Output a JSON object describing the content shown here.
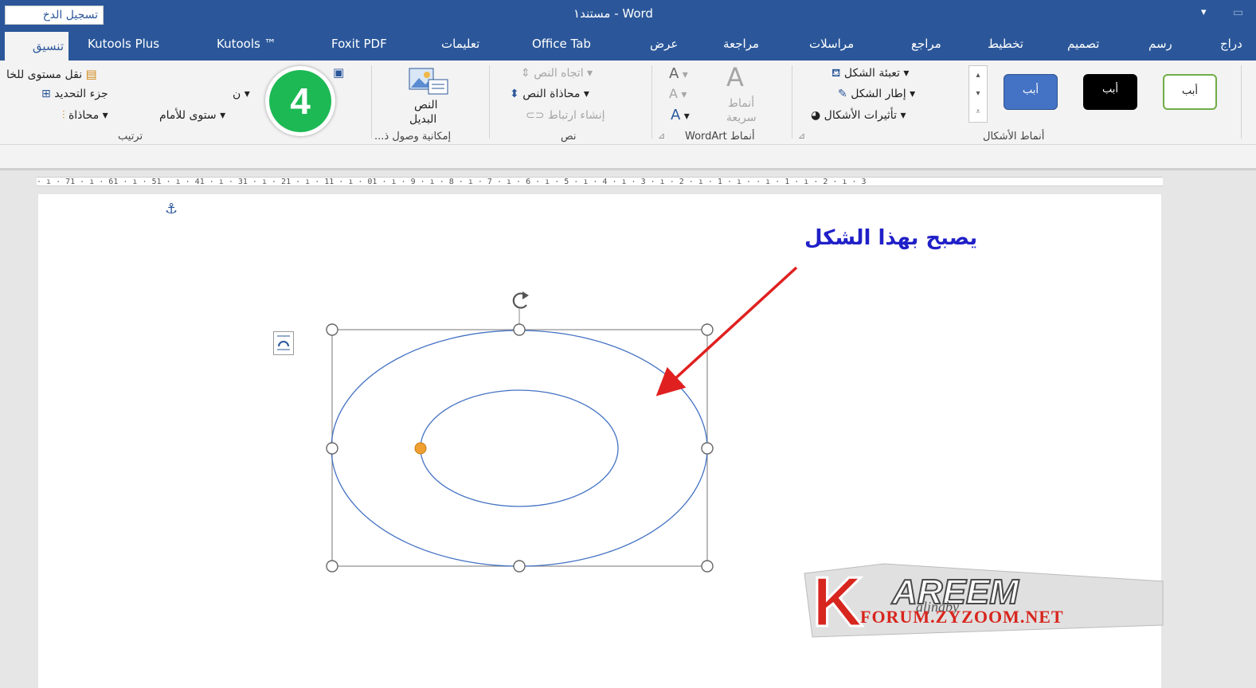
{
  "window": {
    "title": "مستند١ - Word",
    "signin": "تسجيل الدخ",
    "qat_icon": "qat-dropdown-icon"
  },
  "tabs": {
    "format": "تنسيق",
    "kutools_plus": "Kutools Plus",
    "kutools": "Kutools ™",
    "foxit": "Foxit PDF",
    "help": "تعليمات",
    "office_tab": "Office Tab",
    "view": "عرض",
    "review": "مراجعة",
    "mailings": "مراسلات",
    "references": "مراجع",
    "layout": "تخطيط",
    "design": "تصميم",
    "draw": "رسم",
    "insert": "دراج"
  },
  "ribbon": {
    "arrange": {
      "selection_pane": "نقل مستوى للخا",
      "selection": "جزء التحديد",
      "align": "محاذاة",
      "bring_forward": "ستوى للأمام",
      "group_label": "ترتيب"
    },
    "accessibility": {
      "alt_text_line1": "النص",
      "alt_text_line2": "البديل",
      "group_label": "إمكانية وصول ذ..."
    },
    "text": {
      "direction": "اتجاه النص",
      "align_text": "محاذاة النص",
      "create_link": "إنشاء ارتباط",
      "group_label": "نص"
    },
    "wordart": {
      "styles_line1": "أنماط",
      "styles_line2": "سريعة",
      "group_label": "أنماط WordArt"
    },
    "shape_styles": {
      "fill": "تعبئة الشكل",
      "outline": "إطار الشكل",
      "effects": "تأثيرات الأشكال",
      "group_label": "أنماط الأشكال",
      "presets": [
        "أبب",
        "أبب",
        "أبب"
      ]
    }
  },
  "document": {
    "ruler": "· ı · 71 · ı · 61 · ı · 51 · ı · 41 · ı · 31 · ı · 21 · ı · 11 · ı · 01 · ı · 9 · ı · 8 · ı · 7 · ı · 6 · ı · 5 · ı · 4 · ı · 3 · ı · 2 · ı · 1 · ı · · ı · 1 · ı · 2 · ı · 3",
    "annotation": "يصبح بهذا الشكل",
    "step_number": "4"
  },
  "watermark": {
    "letter": "K",
    "name": "AREEM",
    "script": "aljnaby",
    "url": "FORUM.ZYZOOM.NET"
  },
  "colors": {
    "accent": "#2b579a",
    "shape_outline": "#4472c4",
    "arrow": "#e02020",
    "badge": "#1db954",
    "annotation": "#2020c8"
  }
}
